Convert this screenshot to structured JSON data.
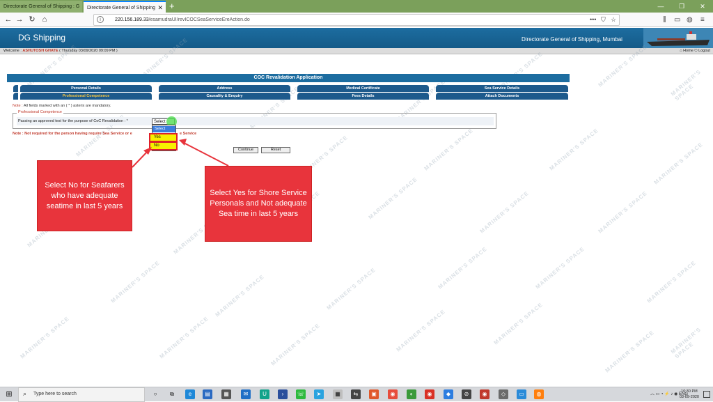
{
  "browser": {
    "tabs": [
      {
        "title": "Directorate General of Shipping : G",
        "active": false
      },
      {
        "title": "Directorate General of Shipping",
        "active": true
      }
    ],
    "url_host": "220.156.189.33",
    "url_path": "/esamudraUI/revICOCSeaServiceEreAction.do",
    "new_tab": "+",
    "win_min": "—",
    "win_max": "❐",
    "win_close": "✕"
  },
  "site": {
    "logo": "DG Shipping",
    "org": "Directorate General of Shipping, Mumbai",
    "welcome_prefix": "Welcome :",
    "user": "ASHUTOSH GHATE",
    "date": "( Thursday 03/09/2020 09:09 PM )",
    "home": "Home",
    "logout": "Logout"
  },
  "form": {
    "title": "COC Revalidation Application",
    "tabs_row1": [
      "Personal Details",
      "Address",
      "Medical Certificate",
      "Sea Service Details"
    ],
    "tabs_row2": [
      "Professional Competence",
      "Causality & Enquiry",
      "Fees Details",
      "Attach Documents"
    ],
    "note_prefix": "Note :",
    "note_text": "All fields marked with an ( * ) asterix are mandatory.",
    "section_legend": "Professional Competence",
    "question": "Passing an approved test for the purpose of CoC Revalidation : *",
    "select_value": "Select",
    "options": [
      "Select",
      "Yes",
      "No"
    ],
    "note2_head": "Note : Not required for the person having require Sea Service or e",
    "note2_tail": "e Service",
    "continue": "Continue",
    "reset": "Reset"
  },
  "callouts": {
    "left": "Select No for Seafarers who have adequate seatime in last 5 years",
    "right": "Select Yes for Shore Service Personals and Not adequate Sea time in last 5 years"
  },
  "watermark": "MARINER'S SPACE",
  "taskbar": {
    "search_placeholder": "Type here to search",
    "lang": "ENG",
    "time": "10:30 PM",
    "date": "03-09-2020"
  },
  "colors": {
    "header_blue": "#1d6da0",
    "callout_red": "#e8343c",
    "highlight_yellow": "#f7f000"
  }
}
